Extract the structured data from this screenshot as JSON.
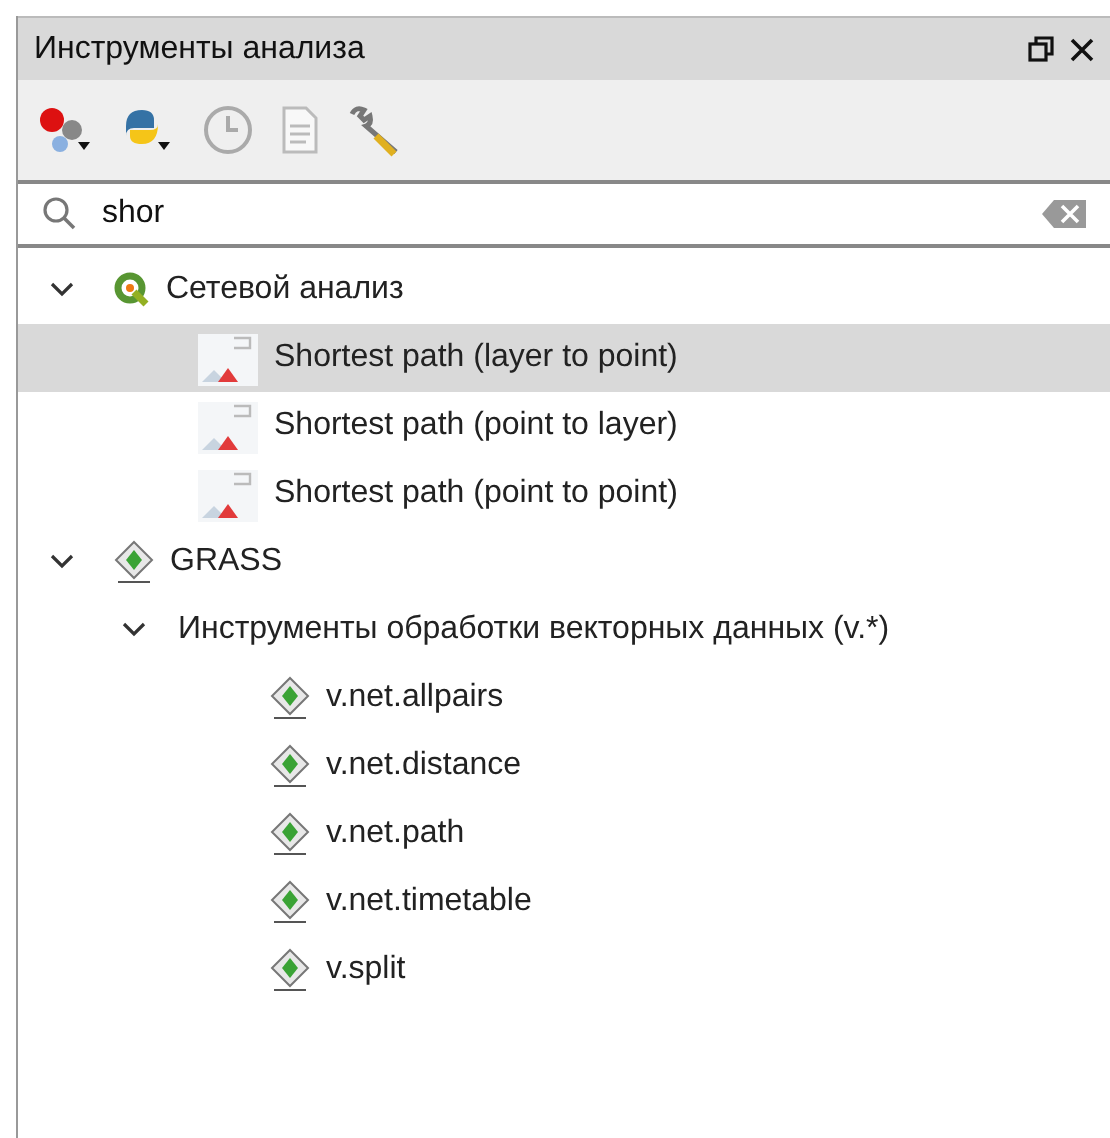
{
  "panel": {
    "title": "Инструменты анализа"
  },
  "search": {
    "value": "shor"
  },
  "tree": [
    {
      "label": "Сетевой анализ",
      "kind": "qgis",
      "expanded": true,
      "children": [
        {
          "label": "Shortest path (layer to point)",
          "kind": "path",
          "selected": true
        },
        {
          "label": "Shortest path (point to layer)",
          "kind": "path",
          "selected": false
        },
        {
          "label": "Shortest path (point to point)",
          "kind": "path",
          "selected": false
        }
      ]
    },
    {
      "label": "GRASS",
      "kind": "grass",
      "expanded": true,
      "children": [
        {
          "label": "Инструменты обработки векторных данных (v.*)",
          "kind": "folder",
          "expanded": true,
          "children": [
            {
              "label": "v.net.allpairs",
              "kind": "grass",
              "selected": false
            },
            {
              "label": "v.net.distance",
              "kind": "grass",
              "selected": false
            },
            {
              "label": "v.net.path",
              "kind": "grass",
              "selected": false
            },
            {
              "label": "v.net.timetable",
              "kind": "grass",
              "selected": false
            },
            {
              "label": "v.split",
              "kind": "grass",
              "selected": false
            }
          ]
        }
      ]
    }
  ]
}
